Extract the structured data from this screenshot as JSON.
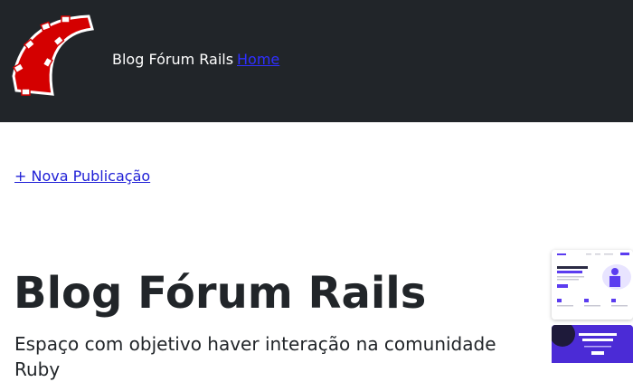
{
  "navbar": {
    "logo_icon": "rails-logo-icon",
    "brand": "Blog Fórum Rails",
    "home_link": "Home"
  },
  "actions": {
    "new_post_link": "+ Nova Publicação"
  },
  "hero": {
    "title": "Blog Fórum Rails",
    "description": "Espaço com objetivo haver interação na comunidade Ruby"
  },
  "colors": {
    "navbar_bg": "#212529",
    "link": "#2f2fff",
    "logo_red": "#cc0000",
    "thumbnail_accent": "#4b2bd6"
  }
}
